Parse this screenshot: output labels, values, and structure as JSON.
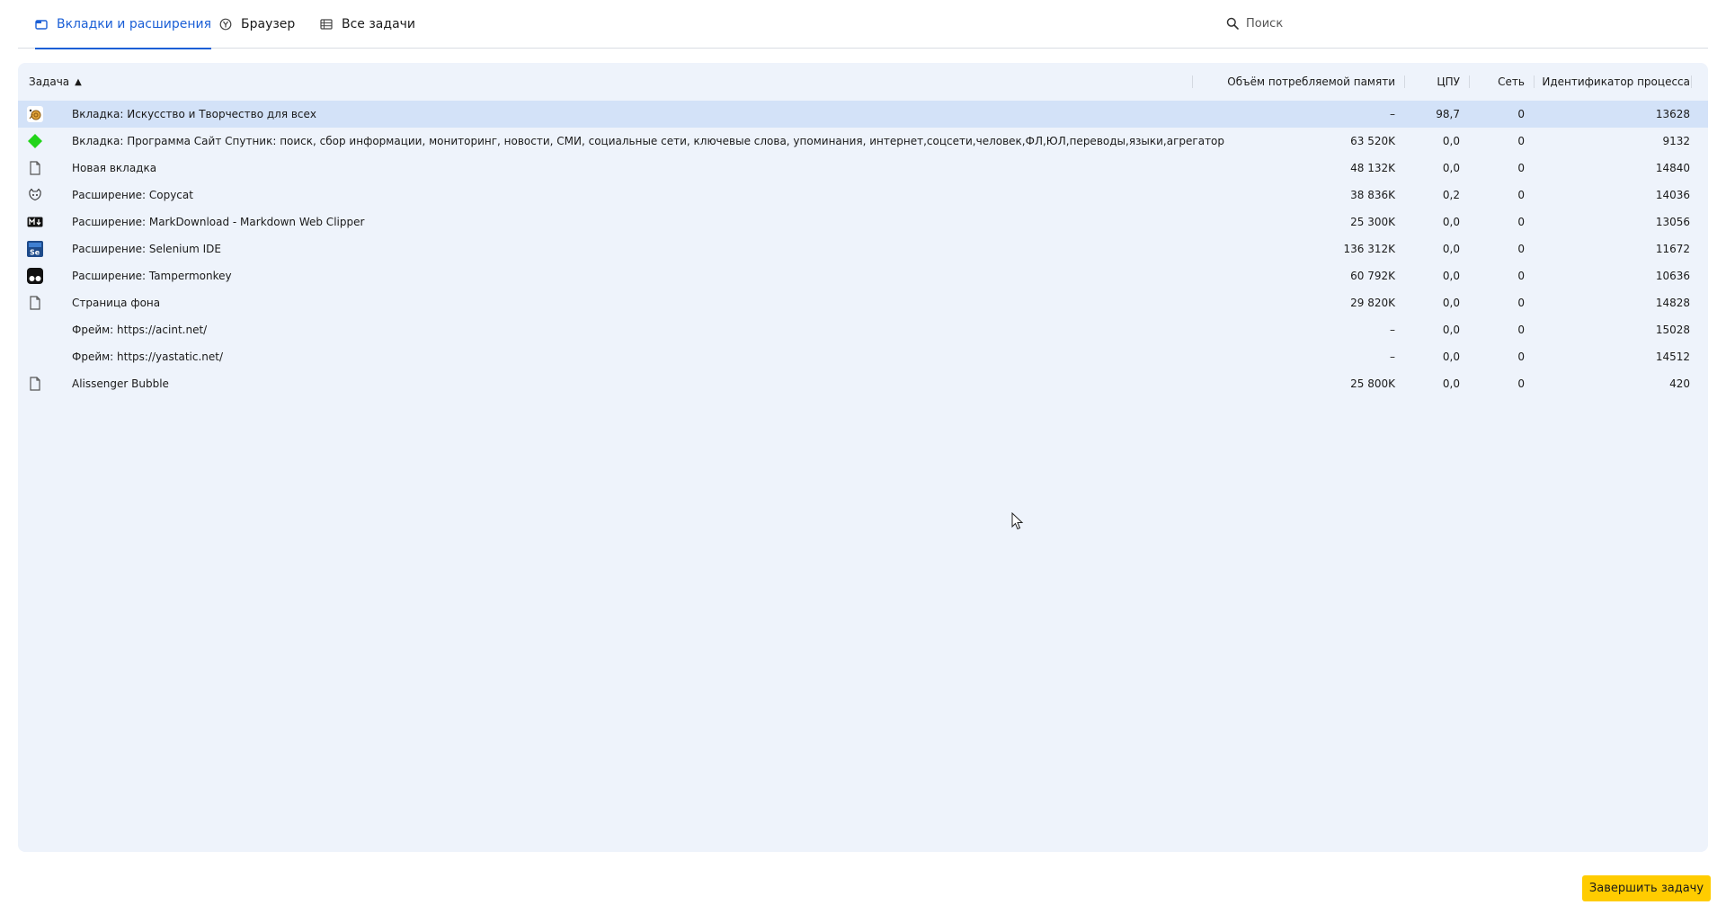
{
  "tabs": [
    {
      "label": "Вкладки и расширения",
      "icon": "tabs-icon",
      "active": true
    },
    {
      "label": "Браузер",
      "icon": "browser-icon",
      "active": false
    },
    {
      "label": "Все задачи",
      "icon": "list-icon",
      "active": false
    }
  ],
  "search": {
    "placeholder": "Поиск"
  },
  "table": {
    "columns": {
      "task": "Задача",
      "sort_indicator": "▲",
      "memory": "Объём потребляемой памяти",
      "cpu": "ЦПУ",
      "network": "Сеть",
      "pid": "Идентификатор процесса"
    },
    "rows": [
      {
        "task": "Вкладка: Искусство и Творчество для всех",
        "memory": "–",
        "cpu": "98,7",
        "network": "0",
        "pid": "13628",
        "icon": "snail-favicon-icon",
        "selected": true
      },
      {
        "task": "Вкладка: Программа Сайт Спутник: поиск, сбор информации, мониторинг, новости, СМИ, социальные сети, ключевые слова, упоминания, интернет,соцсети,человек,ФЛ,ЮЛ,переводы,языки,агрегатор",
        "memory": "63 520K",
        "cpu": "0,0",
        "network": "0",
        "pid": "9132",
        "icon": "green-diamond-icon",
        "selected": false
      },
      {
        "task": "Новая вкладка",
        "memory": "48 132K",
        "cpu": "0,0",
        "network": "0",
        "pid": "14840",
        "icon": "page-icon",
        "selected": false
      },
      {
        "task": "Расширение: Copycat",
        "memory": "38 836K",
        "cpu": "0,2",
        "network": "0",
        "pid": "14036",
        "icon": "cat-icon",
        "selected": false
      },
      {
        "task": "Расширение: MarkDownload - Markdown Web Clipper",
        "memory": "25 300K",
        "cpu": "0,0",
        "network": "0",
        "pid": "13056",
        "icon": "markdown-icon",
        "selected": false
      },
      {
        "task": "Расширение: Selenium IDE",
        "memory": "136 312K",
        "cpu": "0,0",
        "network": "0",
        "pid": "11672",
        "icon": "selenium-icon",
        "selected": false
      },
      {
        "task": "Расширение: Tampermonkey",
        "memory": "60 792K",
        "cpu": "0,0",
        "network": "0",
        "pid": "10636",
        "icon": "tampermonkey-icon",
        "selected": false
      },
      {
        "task": "Страница фона",
        "memory": "29 820K",
        "cpu": "0,0",
        "network": "0",
        "pid": "14828",
        "icon": "page-icon",
        "selected": false
      },
      {
        "task": "Фрейм: https://acint.net/",
        "memory": "–",
        "cpu": "0,0",
        "network": "0",
        "pid": "15028",
        "icon": "",
        "selected": false
      },
      {
        "task": "Фрейм: https://yastatic.net/",
        "memory": "–",
        "cpu": "0,0",
        "network": "0",
        "pid": "14512",
        "icon": "",
        "selected": false
      },
      {
        "task": "Alissenger Bubble",
        "memory": "25 800K",
        "cpu": "0,0",
        "network": "0",
        "pid": "420",
        "icon": "page-icon",
        "selected": false
      }
    ]
  },
  "footer": {
    "end_task_label": "Завершить задачу"
  },
  "colors": {
    "accent": "#1b5fd6",
    "panel_bg": "#eef3fb",
    "selected_row": "#d3e2f8",
    "primary_button": "#ffcc00"
  }
}
